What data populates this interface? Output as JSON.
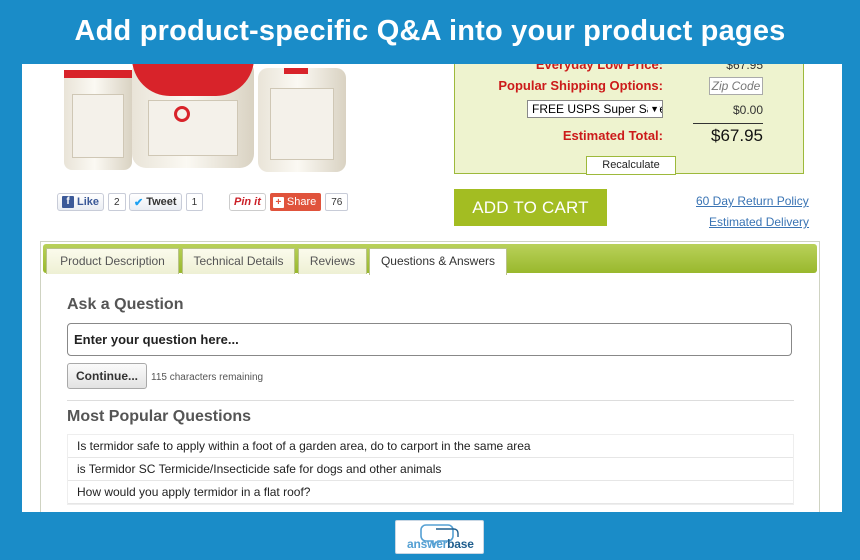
{
  "banner": {
    "title": "Add product-specific Q&A into your product pages"
  },
  "pricing": {
    "everyday_label": "Everyday Low Price:",
    "everyday_value": "$67.95",
    "shipping_label": "Popular Shipping Options:",
    "zip_placeholder": "Zip Code",
    "shipping_option": "FREE USPS Super Saver",
    "shipping_cost": "$0.00",
    "total_label": "Estimated Total:",
    "total_value": "$67.95",
    "recalculate_label": "Recalculate"
  },
  "social": {
    "like_label": "Like",
    "like_count": "2",
    "tweet_label": "Tweet",
    "tweet_count": "1",
    "pin_label": "Pin it",
    "share_label": "Share",
    "share_count": "76"
  },
  "cart": {
    "add_label": "ADD TO CART",
    "return_policy": "60 Day Return Policy",
    "delivery": "Estimated Delivery"
  },
  "tabs": [
    {
      "label": "Product Description",
      "active": false
    },
    {
      "label": "Technical Details",
      "active": false
    },
    {
      "label": "Reviews",
      "active": false
    },
    {
      "label": "Questions & Answers",
      "active": true
    }
  ],
  "qa": {
    "ask_heading": "Ask a Question",
    "input_placeholder": "Enter your question here...",
    "continue_label": "Continue...",
    "remaining": "115 characters remaining",
    "popular_heading": "Most Popular Questions",
    "questions": [
      "Is termidor safe to apply within a foot of a garden area, do to carport in the same area",
      "is Termidor SC Termicide/Insecticide safe for dogs and other animals",
      "How would you apply termidor in a flat roof?"
    ]
  },
  "logo": {
    "part1": "answer",
    "part2": "base"
  },
  "colors": {
    "background": "#1a8cc8",
    "accent": "#a3bd22",
    "price_red": "#cc1a1a"
  },
  "icons": [
    "facebook-icon",
    "twitter-icon",
    "pinterest-icon",
    "share-plus-icon",
    "dropdown-arrow-icon",
    "answerbase-logo-icon"
  ]
}
